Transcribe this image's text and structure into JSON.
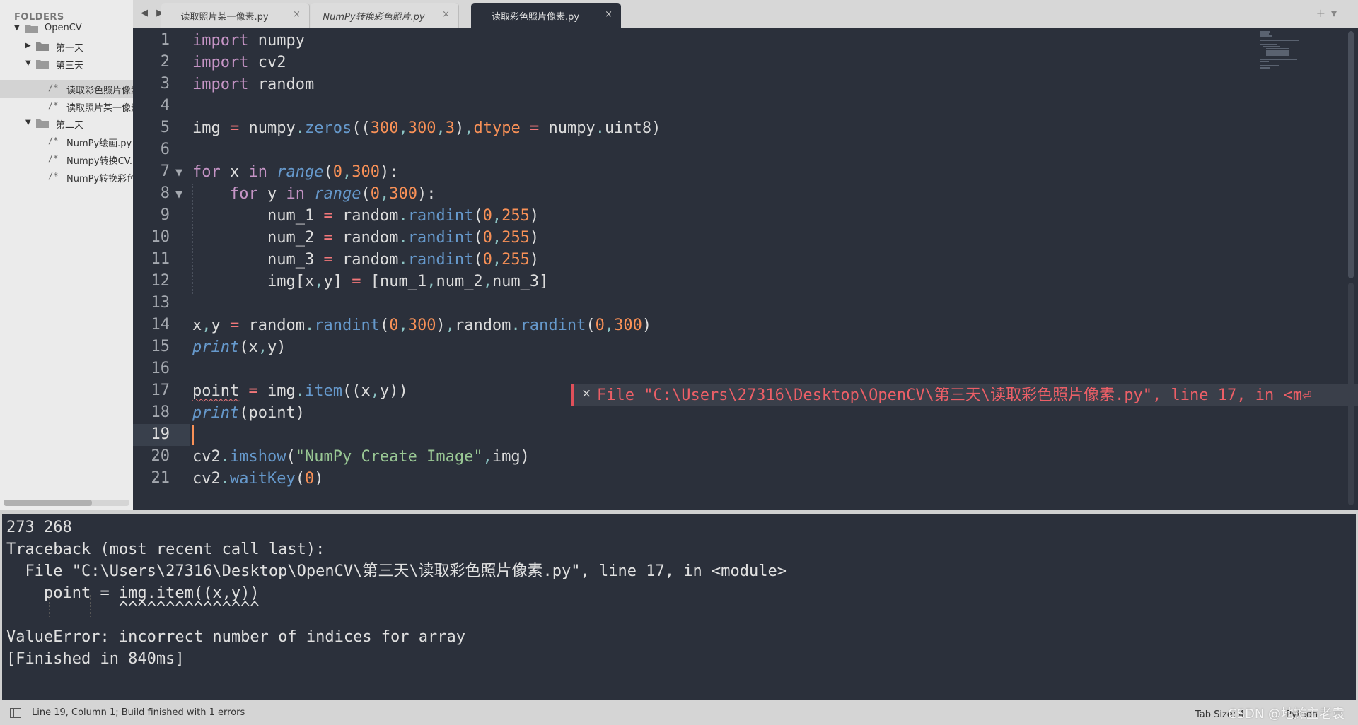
{
  "sidebar": {
    "title": "FOLDERS",
    "items": [
      {
        "label": "OpenCV",
        "kind": "folder",
        "expanded": true
      },
      {
        "label": "第一天",
        "kind": "folder",
        "expanded": false
      },
      {
        "label": "第三天",
        "kind": "folder",
        "expanded": true
      },
      {
        "label": "读取彩色照片像素.py",
        "kind": "file",
        "selected": true
      },
      {
        "label": "读取照片某一像素.py",
        "kind": "file"
      },
      {
        "label": "第二天",
        "kind": "folder",
        "expanded": true
      },
      {
        "label": "NumPy绘画.py",
        "kind": "file"
      },
      {
        "label": "Numpy转换CV.py",
        "kind": "file"
      },
      {
        "label": "NumPy转换彩色照片.py",
        "kind": "file"
      }
    ]
  },
  "tabs": {
    "nav": "◀ ▶",
    "add": "+",
    "menu": "▾",
    "items": [
      {
        "label": "读取照片某一像素.py",
        "active": false,
        "italic": false,
        "close": "×"
      },
      {
        "label": "NumPy转换彩色照片.py",
        "active": false,
        "italic": true,
        "close": "×"
      },
      {
        "label": "读取彩色照片像素.py",
        "active": true,
        "italic": false,
        "close": "×"
      }
    ]
  },
  "editor": {
    "language": "Python",
    "current_line": 19,
    "line_numbers": [
      "1",
      "2",
      "3",
      "4",
      "5",
      "6",
      "7",
      "8",
      "9",
      "10",
      "11",
      "12",
      "13",
      "14",
      "15",
      "16",
      "17",
      "18",
      "19",
      "20",
      "21"
    ],
    "lines": [
      "import numpy",
      "import cv2",
      "import random",
      "",
      "img = numpy.zeros((300,300,3),dtype = numpy.uint8)",
      "",
      "for x in range(0,300):",
      "    for y in range(0,300):",
      "        num_1 = random.randint(0,255)",
      "        num_2 = random.randint(0,255)",
      "        num_3 = random.randint(0,255)",
      "        img[x,y] = [num_1,num_2,num_3]",
      "",
      "x,y = random.randint(0,300),random.randint(0,300)",
      "print(x,y)",
      "",
      "point = img.item((x,y))",
      "print(point)",
      "",
      "cv2.imshow(\"NumPy Create Image\",img)",
      "cv2.waitKey(0)"
    ],
    "tokens": {
      "import": "import",
      "numpy": "numpy",
      "cv2": "cv2",
      "random": "random",
      "img": "img",
      "eq": "=",
      "zeros": "zeros",
      "dtype": "dtype",
      "uint8": "uint8",
      "for": "for",
      "in": "in",
      "range": "range",
      "x": "x",
      "y": "y",
      "num_1": "num_1",
      "num_2": "num_2",
      "num_3": "num_3",
      "randint": "randint",
      "print": "print",
      "point": "point",
      "item": "item",
      "imshow": "imshow",
      "waitKey": "waitKey",
      "n0": "0",
      "n3": "3",
      "n255": "255",
      "n300": "300",
      "str": "\"NumPy Create Image\""
    },
    "inline_error": {
      "icon": "×",
      "text": "File \"C:\\Users\\27316\\Desktop\\OpenCV\\第三天\\读取彩色照片像素.py\", line 17, in <m⏎"
    }
  },
  "output": {
    "lines": [
      "273 268",
      "Traceback (most recent call last):",
      "  File \"C:\\Users\\27316\\Desktop\\OpenCV\\第三天\\读取彩色照片像素.py\", line 17, in <module>",
      "    point = img.item((x,y))",
      "            ^^^^^^^^^^^^^^^",
      "ValueError: incorrect number of indices for array",
      "[Finished in 840ms]"
    ]
  },
  "statusbar": {
    "text": "Line 19, Column 1; Build finished with 1 errors",
    "tab_size": "Tab Size: 4",
    "syntax": "Python",
    "watermark": "CSDN @地摊主老袁"
  },
  "colors": {
    "editor_bg": "#2b303b",
    "sidebar_bg": "#ebebeb",
    "keyword": "#c594c5",
    "operator": "#f2777a",
    "number": "#f99157",
    "function": "#6699cc",
    "string": "#99c794",
    "error": "#ec5f67"
  }
}
